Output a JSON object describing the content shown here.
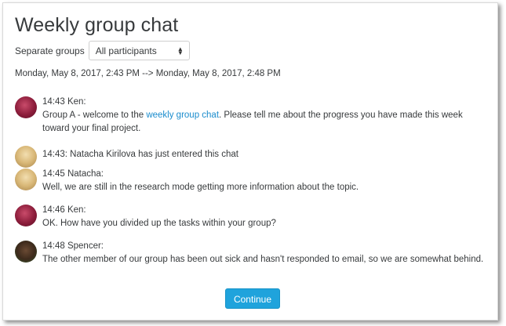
{
  "page": {
    "title": "Weekly group chat",
    "groups_label": "Separate groups",
    "group_select_value": "All participants",
    "date_range": "Monday, May 8, 2017, 2:43 PM --> Monday, May 8, 2017, 2:48 PM",
    "continue_label": "Continue"
  },
  "messages": [
    {
      "header": "14:43 Ken:",
      "text_before": "Group A - welcome to the ",
      "link_text": "weekly group chat",
      "text_after": ". Please tell me about the progress you have made this week toward your final project."
    },
    {
      "header": "14:43: Natacha Kirilova has just entered this chat"
    },
    {
      "header": "14:45 Natacha:",
      "text": "Well, we are still in the research mode getting more information about the topic."
    },
    {
      "header": "14:46 Ken:",
      "text": "OK. How have you divided up the tasks within your group?"
    },
    {
      "header": "14:48 Spencer:",
      "text": "The other member of our group has been out sick and hasn't responded to email, so we are somewhat behind."
    }
  ],
  "colors": {
    "accent": "#1fa3dc",
    "link": "#1a8ccd",
    "text": "#373a3c"
  },
  "icons": {
    "select_arrows": "updown-arrows-icon"
  }
}
